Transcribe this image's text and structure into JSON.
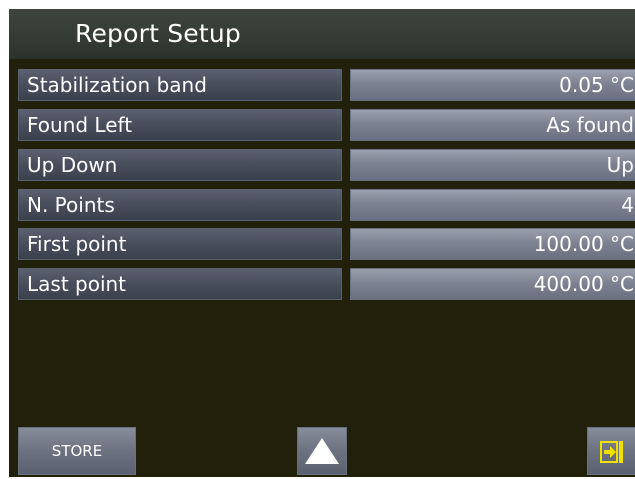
{
  "header": {
    "title": "Report Setup"
  },
  "settings": [
    {
      "label": "Stabilization band",
      "value": "0.05 °C"
    },
    {
      "label": "Found Left",
      "value": "As found"
    },
    {
      "label": "Up Down",
      "value": "Up"
    },
    {
      "label": "N. Points",
      "value": "4"
    },
    {
      "label": "First point",
      "value": "100.00 °C"
    },
    {
      "label": "Last point",
      "value": "400.00 °C"
    }
  ],
  "footer": {
    "store_label": "STORE",
    "up_icon": "triangle-up-icon",
    "exit_icon": "exit-arrow-icon"
  },
  "colors": {
    "screen_background": "#21200a",
    "header_background": "#3e453e",
    "exit_icon_color": "#f0e000"
  }
}
